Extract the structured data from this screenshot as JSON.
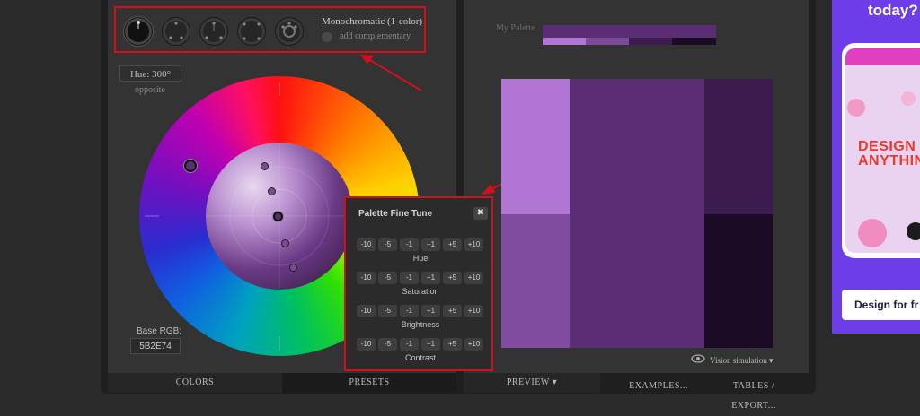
{
  "scheme_selector": {
    "title": "Monochromatic (1-color)",
    "complement_label": "add complementary",
    "buttons": [
      "mono-scheme",
      "complement-scheme",
      "triad-scheme",
      "tetrad-scheme",
      "analogic-scheme"
    ]
  },
  "hue": {
    "value": "Hue: 300°",
    "opposite_label": "opposite"
  },
  "base_rgb": {
    "label": "Base RGB:",
    "value": "5B2E74"
  },
  "fine_tune": {
    "title": "Palette Fine Tune",
    "close_icon": "close-icon",
    "steps": [
      "-10",
      "-5",
      "-1",
      "+1",
      "+5",
      "+10"
    ],
    "groups": [
      "Hue",
      "Saturation",
      "Brightness",
      "Contrast"
    ]
  },
  "left_tabs": {
    "colors": "COLORS",
    "presets": "PRESETS"
  },
  "right_tabs": {
    "preview": "PREVIEW",
    "examples": "EXAMPLES...",
    "tables": "TABLES / EXPORT..."
  },
  "palette": {
    "label": "My Palette",
    "base_color": "#5b2e74",
    "swatches": [
      "#b176d4",
      "#7a4c97",
      "#3c1b4e",
      "#1b0b25"
    ]
  },
  "preview": {
    "colors": [
      "#b176d4",
      "#7f4ca0",
      "#5b2e74",
      "#3c1b4e",
      "#1b0b25"
    ],
    "vision_label": "Vision simulation",
    "vision_icon": "eye-icon"
  },
  "ad": {
    "headline": "today?",
    "design_text_1": "DESIGN",
    "design_text_2": "ANYTHIN",
    "cta": "Design for fr"
  },
  "accents": {
    "annotation_red": "#d0101a",
    "background": "#333333"
  }
}
